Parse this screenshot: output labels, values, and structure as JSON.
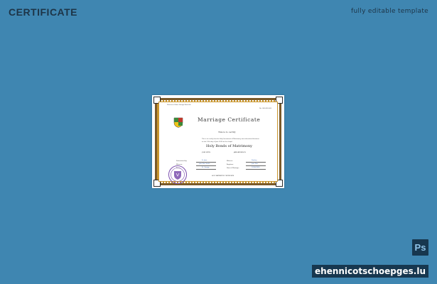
{
  "page": {
    "title": "CERTIFICATE",
    "subtitle": "fully editable template"
  },
  "certificate": {
    "top_left_small": "Diocese of Saint George Rockville",
    "top_right_small": "No. 000-000-000",
    "title": "Marriage Certificate",
    "witness": "This is to certify",
    "body_line_1": "This is to certify that the Holy Sacrament of Matrimony was solemnized between",
    "body_line_2": "on the 12th day of June 2020 at the chapel",
    "sacrament": "Holy Bonds of Matrimony",
    "groom_label": "JOHN SMITH",
    "bride_label": "JANE ANDERSON",
    "left_fields": [
      {
        "label": "Solemnized by:",
        "value": "Fr. Joan"
      },
      {
        "label": "Witness:",
        "value": "John Doe Smith"
      },
      {
        "label": "Place:",
        "value": "St. George"
      }
    ],
    "right_fields": [
      {
        "label": "Witness:",
        "value": "Stanley"
      },
      {
        "label": "Registrar:",
        "value": "Jane Doe"
      },
      {
        "label": "Date of Marriage:",
        "value": "12/06/2020"
      }
    ],
    "bottom_text": "HOLY MATRIMONY CERTIFICATE"
  },
  "icons": {
    "ps": "photoshop-icon",
    "crest": "crest-icon",
    "seal": "seal-icon"
  },
  "badges": {
    "ps_label": "Ps",
    "watermark": "ehennicotschoepges.lu"
  },
  "colors": {
    "background": "#3f86b1",
    "title_text": "#1d3447",
    "border_gold": "#c9962f",
    "signature_blue": "#2e5fb0",
    "seal_purple": "#7b4fae"
  }
}
